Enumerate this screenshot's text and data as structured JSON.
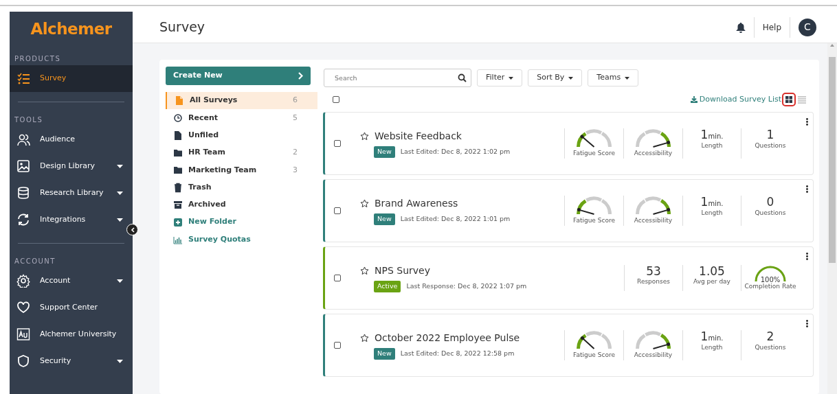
{
  "sidebar": {
    "logo": "Alchemer",
    "sections": [
      {
        "heading": "PRODUCTS",
        "items": [
          {
            "label": "Survey",
            "selected": true,
            "expandable": false
          }
        ]
      },
      {
        "heading": "TOOLS",
        "items": [
          {
            "label": "Audience",
            "selected": false,
            "expandable": false
          },
          {
            "label": "Design Library",
            "selected": false,
            "expandable": true
          },
          {
            "label": "Research Library",
            "selected": false,
            "expandable": true
          },
          {
            "label": "Integrations",
            "selected": false,
            "expandable": true
          }
        ]
      },
      {
        "heading": "ACCOUNT",
        "items": [
          {
            "label": "Account",
            "selected": false,
            "expandable": true
          },
          {
            "label": "Support Center",
            "selected": false,
            "expandable": false
          },
          {
            "label": "Alchemer University",
            "selected": false,
            "expandable": false
          },
          {
            "label": "Security",
            "selected": false,
            "expandable": true
          }
        ]
      }
    ]
  },
  "header": {
    "title": "Survey",
    "help": "Help",
    "avatar": "C"
  },
  "create_button": "Create New",
  "folders": [
    {
      "label": "All Surveys",
      "count": "6",
      "selected": true,
      "kind": "folder"
    },
    {
      "label": "Recent",
      "count": "5",
      "selected": false,
      "kind": "folder"
    },
    {
      "label": "Unfiled",
      "selected": false,
      "kind": "folder"
    },
    {
      "label": "HR Team",
      "count": "2",
      "selected": false,
      "kind": "folder"
    },
    {
      "label": "Marketing Team",
      "count": "3",
      "selected": false,
      "kind": "folder"
    },
    {
      "label": "Trash",
      "selected": false,
      "kind": "folder"
    },
    {
      "label": "Archived",
      "selected": false,
      "kind": "folder"
    },
    {
      "label": "New Folder",
      "selected": false,
      "kind": "action"
    },
    {
      "label": "Survey Quotas",
      "selected": false,
      "kind": "action"
    }
  ],
  "toolbar": {
    "search": {
      "placeholder": "Search"
    },
    "dropdowns": [
      "Filter",
      "Sort By",
      "Teams"
    ],
    "download": "Download Survey List",
    "views": [
      {
        "selected": true
      },
      {
        "selected": false
      }
    ]
  },
  "select_all": {
    "checked": false
  },
  "surveys": [
    {
      "title": "Website Feedback",
      "checked": false,
      "starred": false,
      "status": {
        "label": "New",
        "color": "#2f7f7a"
      },
      "meta": "Last Edited: Dec 8, 2022 1:02 pm",
      "stats": [
        {
          "kind": "gauge",
          "level": 0.12,
          "label": "Fatigue Score"
        },
        {
          "kind": "gauge",
          "level": 0.98,
          "label": "Accessibility"
        },
        {
          "kind": "number",
          "value": "1",
          "unit": "min.",
          "label": "Length"
        },
        {
          "kind": "number",
          "value": "1",
          "label": "Questions"
        }
      ]
    },
    {
      "title": "Brand Awareness",
      "checked": false,
      "starred": false,
      "status": {
        "label": "New",
        "color": "#2f7f7a"
      },
      "meta": "Last Edited: Dec 8, 2022 1:01 pm",
      "stats": [
        {
          "kind": "gauge",
          "level": 0.02,
          "label": "Fatigue Score"
        },
        {
          "kind": "gauge",
          "level": 0.98,
          "label": "Accessibility"
        },
        {
          "kind": "number",
          "value": "1",
          "unit": "min.",
          "label": "Length"
        },
        {
          "kind": "number",
          "value": "0",
          "label": "Questions"
        }
      ]
    },
    {
      "title": "NPS Survey",
      "checked": false,
      "starred": false,
      "status": {
        "label": "Active",
        "color": "#6aa313"
      },
      "meta": "Last Response: Dec 8, 2022 1:07 pm",
      "stats": [
        {
          "kind": "number",
          "value": "53",
          "label": "Responses"
        },
        {
          "kind": "number",
          "value": "1.05",
          "label": "Avg per day"
        },
        {
          "kind": "ring",
          "value": "100%",
          "level": 1,
          "label": "Completion Rate"
        }
      ]
    },
    {
      "title": "October 2022 Employee Pulse",
      "checked": false,
      "starred": false,
      "status": {
        "label": "New",
        "color": "#2f7f7a"
      },
      "meta": "Last Edited: Dec 8, 2022 12:58 pm",
      "stats": [
        {
          "kind": "gauge",
          "level": 0.13,
          "label": "Fatigue Score"
        },
        {
          "kind": "gauge",
          "level": 0.98,
          "label": "Accessibility"
        },
        {
          "kind": "number",
          "value": "1",
          "unit": "min.",
          "label": "Length"
        },
        {
          "kind": "number",
          "value": "2",
          "label": "Questions"
        }
      ]
    }
  ]
}
